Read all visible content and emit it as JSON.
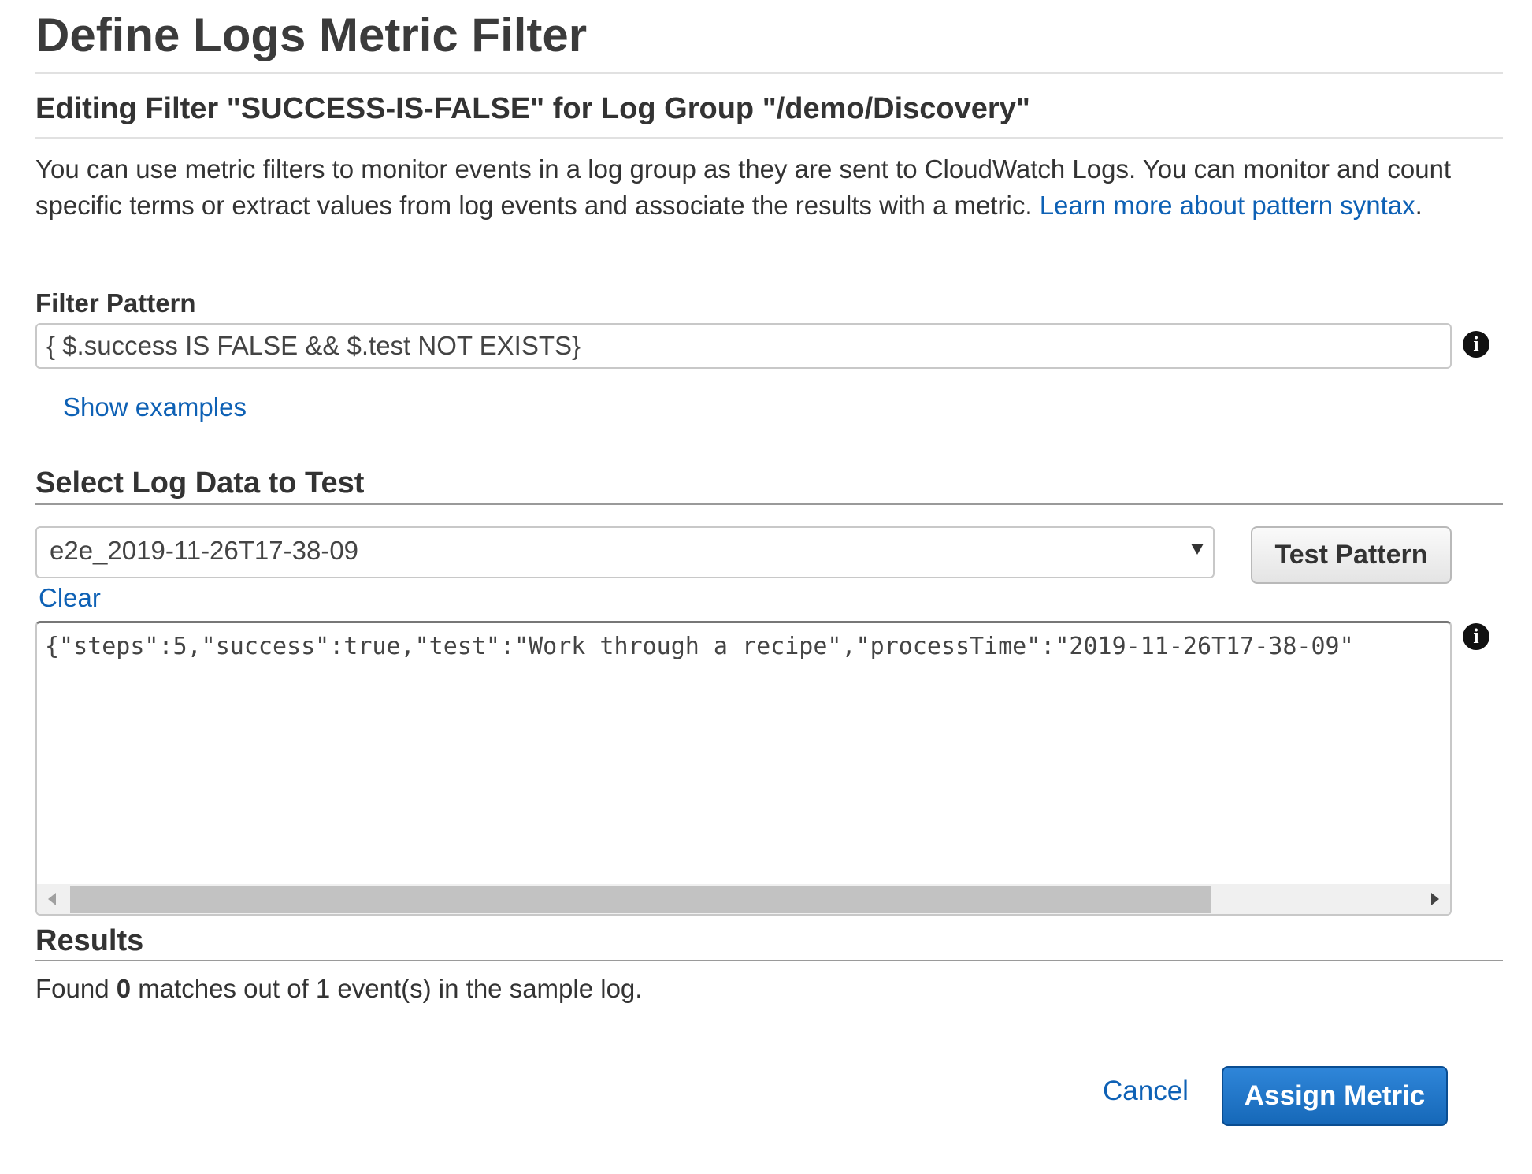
{
  "page": {
    "title": "Define Logs Metric Filter",
    "subtitle": "Editing Filter \"SUCCESS-IS-FALSE\" for Log Group \"/demo/Discovery\"",
    "description": "You can use metric filters to monitor events in a log group as they are sent to CloudWatch Logs. You can monitor and count specific terms or extract values from log events and associate the results with a metric. ",
    "learn_more_link": "Learn more about pattern syntax",
    "description_end": "."
  },
  "filter_pattern": {
    "label": "Filter Pattern",
    "value": "{ $.success IS FALSE && $.test NOT EXISTS}",
    "info_icon": "info-icon",
    "show_examples": "Show examples"
  },
  "log_data": {
    "heading": "Select Log Data to Test",
    "selected_option": "e2e_2019-11-26T17-38-09",
    "test_button": "Test Pattern",
    "clear_link": "Clear",
    "sample_log": "{\"steps\":5,\"success\":true,\"test\":\"Work through a recipe\",\"processTime\":\"2019-11-26T17-38-09\""
  },
  "results": {
    "heading": "Results",
    "text_before": "Found ",
    "match_count": "0",
    "text_after": " matches out of 1 event(s) in the sample log."
  },
  "footer": {
    "cancel_label": "Cancel",
    "assign_label": "Assign Metric"
  },
  "colors": {
    "link": "#0e61b5",
    "primary_button": "#1668b8",
    "text": "#333333"
  }
}
